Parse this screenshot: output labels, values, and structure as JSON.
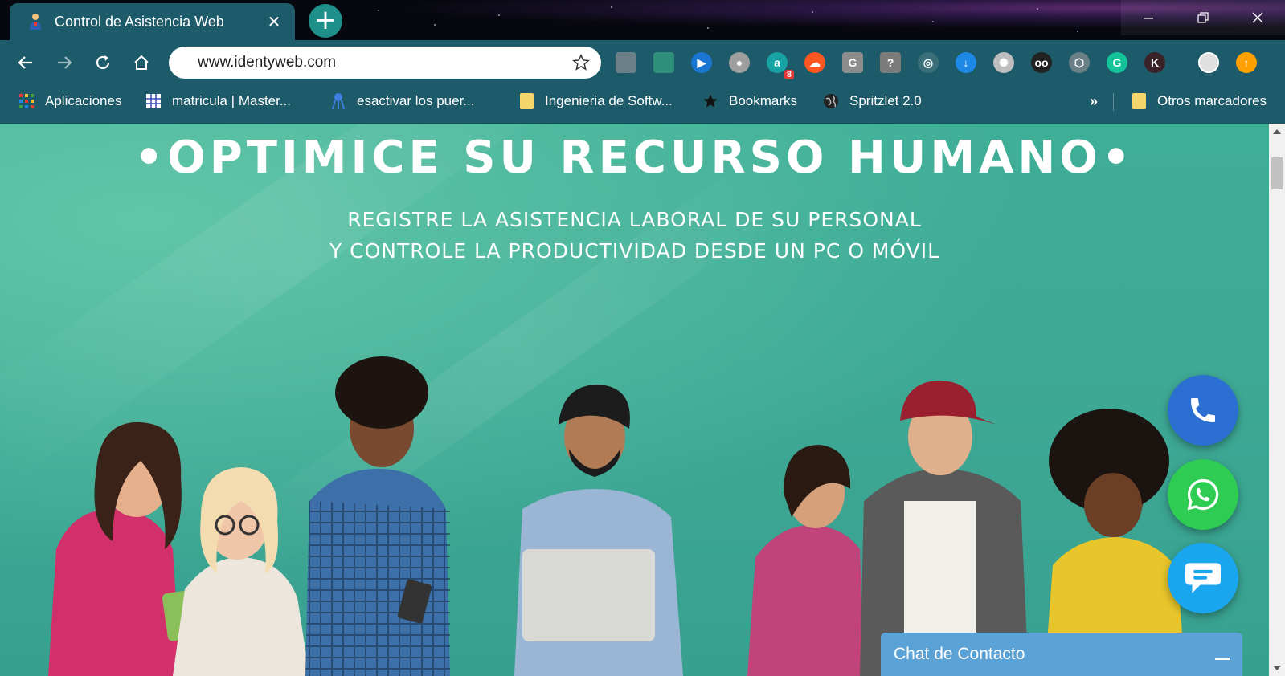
{
  "browser": {
    "tab": {
      "title": "Control de Asistencia Web",
      "favicon": "person-icon",
      "close": "✕"
    },
    "new_tab": "+",
    "window_controls": {
      "minimize": "minimize-icon",
      "maximize": "restore-icon",
      "close": "close-icon"
    },
    "toolbar": {
      "back": "back-arrow-icon",
      "forward": "forward-arrow-icon",
      "reload": "reload-icon",
      "home": "home-icon",
      "url": "www.identyweb.com",
      "bookmark_star": "star-icon"
    },
    "extensions": [
      {
        "name": "shield-ext",
        "label": "",
        "color": "#6b7f86"
      },
      {
        "name": "screen-ext",
        "label": "",
        "color": "#2f8f79"
      },
      {
        "name": "play-ext",
        "label": "▶",
        "color": "#1976d2"
      },
      {
        "name": "record-ext",
        "label": "●",
        "color": "#9e9e9e"
      },
      {
        "name": "grammar-ext",
        "label": "a",
        "color": "#17a2a4",
        "badge": "8"
      },
      {
        "name": "cloud-ext",
        "label": "☁",
        "color": "#ff5722"
      },
      {
        "name": "g-ext",
        "label": "G",
        "color": "#8d8d8d"
      },
      {
        "name": "help-ext",
        "label": "?",
        "color": "#7b7b7b"
      },
      {
        "name": "wifi-ext",
        "label": "◎",
        "color": "#3a6e78"
      },
      {
        "name": "download-ext",
        "label": "↓",
        "color": "#1e88e5"
      },
      {
        "name": "film-ext",
        "label": "✺",
        "color": "#bdbdbd"
      },
      {
        "name": "glasses-ext",
        "label": "oo",
        "color": "#222222"
      },
      {
        "name": "hex-ext",
        "label": "⬡",
        "color": "#6b7f86"
      },
      {
        "name": "grammarly-ext",
        "label": "G",
        "color": "#15c39a"
      },
      {
        "name": "k-ext",
        "label": "K",
        "color": "#3a2228"
      },
      {
        "name": "profile-avatar",
        "label": "",
        "color": "#e0e0e0"
      },
      {
        "name": "update-ext",
        "label": "↑",
        "color": "#ffa000"
      }
    ],
    "bookmarks": [
      {
        "name": "bookmark-apps",
        "label": "Aplicaciones",
        "icon": "apps-grid-icon"
      },
      {
        "name": "bookmark-matricula",
        "label": "matricula | Master...",
        "icon": "grid-icon"
      },
      {
        "name": "bookmark-esactivar",
        "label": "esactivar   los  puer...",
        "icon": "tool-icon"
      },
      {
        "name": "bookmark-ingenieria",
        "label": "Ingenieria de Softw...",
        "icon": "folder-icon"
      },
      {
        "name": "bookmark-bookmarks",
        "label": "Bookmarks",
        "icon": "star-icon"
      },
      {
        "name": "bookmark-spritzlet",
        "label": "Spritzlet 2.0",
        "icon": "globe-icon"
      }
    ],
    "bookmarks_overflow": "»",
    "other_bookmarks": "Otros marcadores"
  },
  "hero": {
    "title": "•OPTIMICE SU RECURSO HUMANO•",
    "subtitle_line1": "REGISTRE LA ASISTENCIA LABORAL DE SU PERSONAL",
    "subtitle_line2": "Y  CONTROLE  LA PRODUCTIVIDAD DESDE UN PC O MÓVIL"
  },
  "contact": {
    "phone": "phone-icon",
    "whatsapp": "whatsapp-icon",
    "chat": "chat-bubble-icon",
    "chat_bar_label": "Chat de Contacto"
  },
  "colors": {
    "chrome": "#1e5b6a",
    "hero_bg": "#3fae97",
    "phone": "#2a6fd1",
    "whatsapp": "#2ecc52",
    "chat": "#1aa6ee",
    "chat_bar": "#5ba3d6"
  }
}
